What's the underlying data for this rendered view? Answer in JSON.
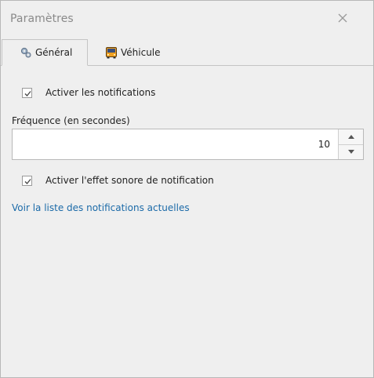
{
  "window": {
    "title": "Paramètres",
    "close_icon": "close-icon"
  },
  "tabs": [
    {
      "label": "Général",
      "icon": "gears-icon",
      "active": true
    },
    {
      "label": "Véhicule",
      "icon": "bus-icon",
      "active": false
    }
  ],
  "general": {
    "notifications_checkbox": {
      "label": "Activer les notifications",
      "checked": true
    },
    "frequency": {
      "label": "Fréquence (en secondes)",
      "value": "10"
    },
    "sound_checkbox": {
      "label": "Activer l'effet sonore de notification",
      "checked": true
    },
    "notifications_link": "Voir la liste des notifications actuelles"
  },
  "colors": {
    "background": "#efefef",
    "link": "#1b6aa8",
    "title_text": "#8a8a8a",
    "border": "#c4c4c4"
  }
}
